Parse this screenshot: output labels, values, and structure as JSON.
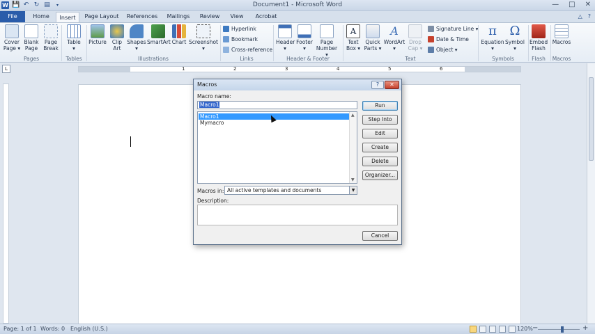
{
  "window": {
    "title": "Document1 - Microsoft Word",
    "logo": "W",
    "controls": [
      "—",
      "□",
      "✕"
    ],
    "quick_access_icons": [
      "save-icon",
      "undo-icon",
      "redo-icon",
      "print-preview-icon"
    ]
  },
  "tabs": [
    {
      "label": "File"
    },
    {
      "label": "Home"
    },
    {
      "label": "Insert"
    },
    {
      "label": "Page Layout"
    },
    {
      "label": "References"
    },
    {
      "label": "Mailings"
    },
    {
      "label": "Review"
    },
    {
      "label": "View"
    },
    {
      "label": "Acrobat"
    }
  ],
  "ribbon": {
    "groups": [
      "Pages",
      "Tables",
      "Illustrations",
      "Links",
      "Header & Footer",
      "Text",
      "Symbols",
      "Flash",
      "Macros"
    ],
    "buttons": {
      "cover_page": [
        "Cover",
        "Page ▾"
      ],
      "blank_page": [
        "Blank",
        "Page"
      ],
      "page_break": [
        "Page",
        "Break"
      ],
      "table": [
        "Table",
        "▾"
      ],
      "picture": "Picture",
      "clip_art": [
        "Clip",
        "Art"
      ],
      "shapes": [
        "Shapes",
        "▾"
      ],
      "smartart": "SmartArt",
      "chart": "Chart",
      "screenshot": [
        "Screenshot",
        "▾"
      ],
      "hyperlink": "Hyperlink",
      "bookmark": "Bookmark",
      "cross_reference": "Cross-reference",
      "header": [
        "Header",
        "▾"
      ],
      "footer": [
        "Footer",
        "▾"
      ],
      "page_number": [
        "Page",
        "Number ▾"
      ],
      "text_box": [
        "Text",
        "Box ▾"
      ],
      "quick_parts": [
        "Quick",
        "Parts ▾"
      ],
      "wordart": [
        "WordArt",
        "▾"
      ],
      "drop_cap": [
        "Drop",
        "Cap ▾"
      ],
      "signature_line": "Signature Line ▾",
      "date_time": "Date & Time",
      "object": "Object ▾",
      "equation": [
        "Equation",
        "▾"
      ],
      "symbol": [
        "Symbol",
        "▾"
      ],
      "embed_flash": [
        "Embed",
        "Flash"
      ],
      "macros": "Macros"
    }
  },
  "ruler": {
    "corner": "L",
    "numbers": [
      "1",
      "2",
      "3",
      "4",
      "5",
      "6"
    ]
  },
  "dialog": {
    "title": "Macros",
    "help": "?",
    "close": "✕",
    "macro_name_label": "Macro name:",
    "macro_name_value": "Macro1",
    "macros": [
      "Macro1",
      "Mymacro"
    ],
    "selected_macro": "Macro1",
    "buttons": {
      "run": "Run",
      "step_into": "Step Into",
      "edit": "Edit",
      "create": "Create",
      "delete": "Delete",
      "organizer": "Organizer...",
      "cancel": "Cancel"
    },
    "macros_in_label": "Macros in:",
    "macros_in_value": "All active templates and documents",
    "description_label": "Description:"
  },
  "status": {
    "page": "Page: 1 of 1",
    "words": "Words: 0",
    "language": "English (U.S.)",
    "zoom": "120%",
    "zoom_minus": "−",
    "zoom_plus": "+"
  },
  "colors": {
    "file_tab": "#2a5caa",
    "selection": "#3399ff",
    "dialog_close": "#c6412d"
  }
}
